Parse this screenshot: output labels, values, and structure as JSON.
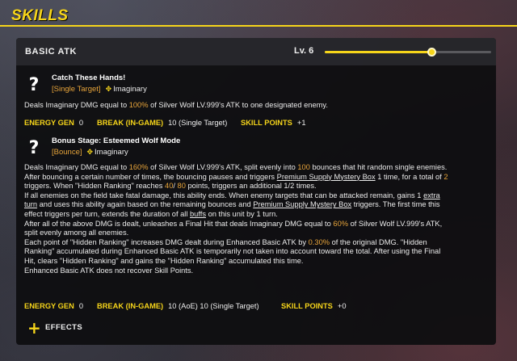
{
  "header": {
    "title": "SKILLS"
  },
  "colors": {
    "accent": "#f6d51a",
    "highlight": "#e7a43a",
    "panel_bg": "#0e0e10"
  },
  "skill_panel": {
    "title": "BASIC ATK",
    "level_label": "Lv. 6",
    "level_progress": 0.64
  },
  "skills": [
    {
      "icon": "question-mark-icon",
      "name": "Catch These Hands!",
      "type_tag": "[Single Target]",
      "element_icon": "imaginary-element-icon",
      "element": "Imaginary",
      "description": [
        [
          {
            "t": "Deals Imaginary DMG equal to "
          },
          {
            "t": "100%",
            "s": "hl"
          },
          {
            "t": " of Silver Wolf LV.999's ATK to one designated enemy."
          }
        ]
      ],
      "stats": [
        {
          "key": "ENERGY GEN",
          "value": "0"
        },
        {
          "key": "BREAK (IN-GAME)",
          "value": "10 (Single Target)"
        },
        {
          "key": "SKILL POINTS",
          "value": "+1"
        }
      ]
    },
    {
      "icon": "question-mark-icon",
      "name": "Bonus Stage: Esteemed Wolf Mode",
      "type_tag": "[Bounce]",
      "element_icon": "imaginary-element-icon",
      "element": "Imaginary",
      "description": [
        [
          {
            "t": "Deals Imaginary DMG equal to "
          },
          {
            "t": "160%",
            "s": "hl"
          },
          {
            "t": " of Silver Wolf LV.999's ATK, split evenly into "
          },
          {
            "t": "100",
            "s": "hl"
          },
          {
            "t": " bounces that hit random single enemies."
          }
        ],
        [
          {
            "t": "After bouncing a certain number of times, the bouncing pauses and triggers "
          },
          {
            "t": "Premium Supply Mystery Box",
            "s": "ul"
          },
          {
            "t": " 1 time, for a total of "
          },
          {
            "t": "2",
            "s": "hl"
          }
        ],
        [
          {
            "t": "triggers. When \"Hidden Ranking\" reaches "
          },
          {
            "t": "40",
            "s": "hl"
          },
          {
            "t": "/ "
          },
          {
            "t": "80",
            "s": "hl"
          },
          {
            "t": " points, triggers an additional 1/2 times."
          }
        ],
        [
          {
            "t": "If all enemies on the field take fatal damage, this ability ends. When enemy targets that can be attacked remain, gains 1 "
          },
          {
            "t": "extra",
            "s": "ul"
          }
        ],
        [
          {
            "t": "turn",
            "s": "ul"
          },
          {
            "t": " and uses this ability again based on the remaining bounces and "
          },
          {
            "t": "Premium Supply Mystery Box",
            "s": "ul"
          },
          {
            "t": " triggers. The first time this"
          }
        ],
        [
          {
            "t": "effect triggers per turn, extends the duration of all "
          },
          {
            "t": "buffs",
            "s": "ul"
          },
          {
            "t": " on this unit by 1 turn."
          }
        ],
        [
          {
            "t": "After all of the above DMG is dealt, unleashes a Final Hit that deals Imaginary DMG equal to "
          },
          {
            "t": "60%",
            "s": "hl"
          },
          {
            "t": " of Silver Wolf LV.999's ATK,"
          }
        ],
        [
          {
            "t": "split evenly among all enemies."
          }
        ],
        [
          {
            "t": "Each point of \"Hidden Ranking\" increases DMG dealt during Enhanced Basic ATK by "
          },
          {
            "t": "0.30%",
            "s": "hl"
          },
          {
            "t": " of the original DMG. \"Hidden"
          }
        ],
        [
          {
            "t": "Ranking\" accumulated during Enhanced Basic ATK is temporarily not taken into account toward the total. After using the Final"
          }
        ],
        [
          {
            "t": "Hit, clears \"Hidden Ranking\" and gains the \"Hidden Ranking\" accumulated this time."
          }
        ],
        [
          {
            "t": "Enhanced Basic ATK does not recover Skill Points."
          }
        ]
      ],
      "stats": [
        {
          "key": "ENERGY GEN",
          "value": "0"
        },
        {
          "key": "BREAK (IN-GAME)",
          "value": "10 (AoE) 10 (Single Target)"
        },
        {
          "key": "SKILL POINTS",
          "value": "+0"
        }
      ]
    }
  ],
  "effects": {
    "icon": "plus-icon",
    "label": "EFFECTS"
  }
}
